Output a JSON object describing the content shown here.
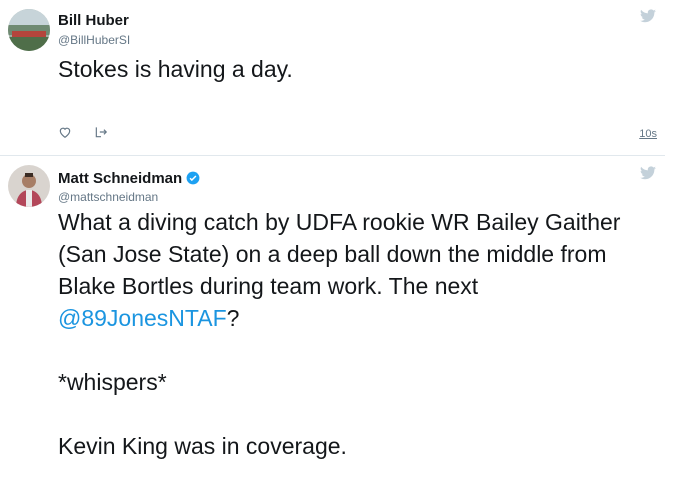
{
  "tweets": [
    {
      "display_name": "Bill Huber",
      "handle": "@BillHuberSI",
      "text": "Stokes is having a day.",
      "timestamp": "10s",
      "avatar": "field-photo",
      "icons": [
        "heart-icon",
        "share-icon",
        "twitter-bird-icon"
      ]
    },
    {
      "display_name": "Matt Schneidman",
      "handle": "@mattschneidman",
      "verified": true,
      "text_line_1": "What a diving catch by UDFA rookie WR Bailey Gaither (San Jose State) on a deep ball down the middle from Blake Bortles during team work. The next ",
      "mention": "@89JonesNTAF",
      "text_line_1_end": "?",
      "text_line_2": "*whispers*",
      "text_line_3": "Kevin King was in coverage.",
      "avatar": "person-photo",
      "icons": [
        "verified-badge-icon",
        "twitter-bird-icon"
      ]
    }
  ],
  "colors": {
    "link": "#1b95e0",
    "secondary_text": "#657786",
    "divider": "#e1e8ed",
    "bird": "#c4d1da",
    "verified": "#1da1f2"
  }
}
